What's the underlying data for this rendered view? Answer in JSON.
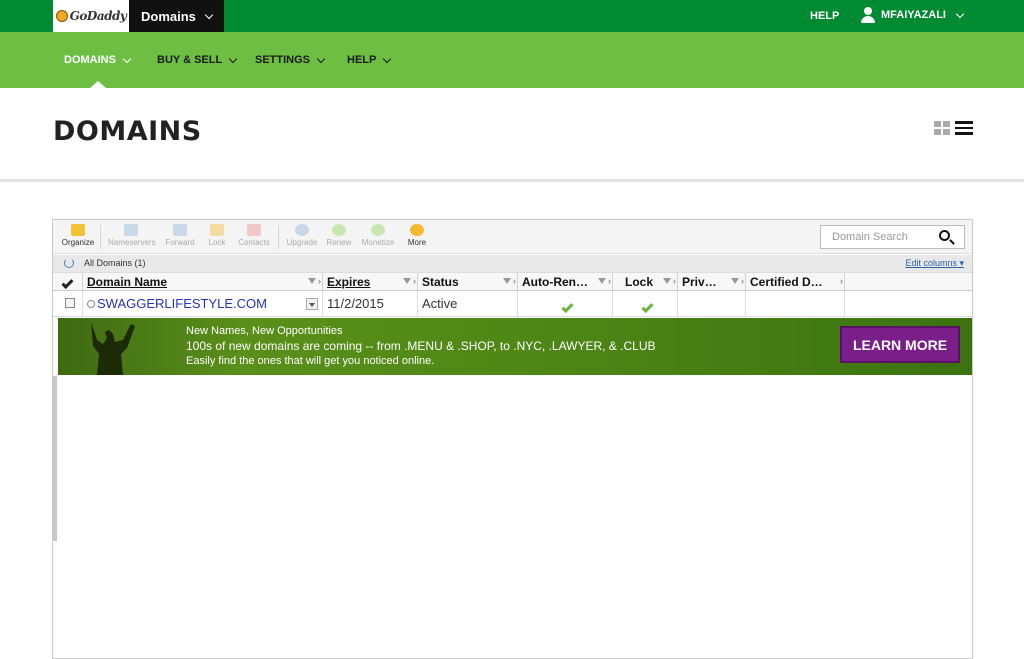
{
  "topbar": {
    "logo_text": "GoDaddy",
    "product_switch": "Domains",
    "help": "HELP",
    "username": "MFAIYAZALI"
  },
  "nav": {
    "items": [
      {
        "label": "DOMAINS"
      },
      {
        "label": "BUY & SELL"
      },
      {
        "label": "SETTINGS"
      },
      {
        "label": "HELP"
      }
    ]
  },
  "page": {
    "title": "DOMAINS"
  },
  "toolbar": {
    "tools": [
      {
        "label": "Organize",
        "enabled": true
      },
      {
        "label": "Nameservers",
        "enabled": false
      },
      {
        "label": "Forward",
        "enabled": false
      },
      {
        "label": "Lock",
        "enabled": false
      },
      {
        "label": "Contacts",
        "enabled": false
      },
      {
        "label": "Upgrade",
        "enabled": false
      },
      {
        "label": "Renew",
        "enabled": false
      },
      {
        "label": "Monetize",
        "enabled": false
      },
      {
        "label": "More",
        "enabled": true
      }
    ],
    "search_placeholder": "Domain Search"
  },
  "list": {
    "all_label": "All Domains (1)",
    "edit_columns": "Edit columns",
    "columns": [
      "Domain Name",
      "Expires",
      "Status",
      "Auto-Ren…",
      "Lock",
      "Priv…",
      "Certified D…"
    ],
    "rows": [
      {
        "domain": "SWAGGERLIFESTYLE.COM",
        "expires": "11/2/2015",
        "status": "Active",
        "auto_renew": true,
        "lock": true
      }
    ]
  },
  "banner": {
    "line1": "New Names, New Opportunities",
    "line2": "100s of new domains are coming -- from .MENU & .SHOP, to .NYC, .LAWYER, & .CLUB",
    "line3": "Easily find the ones that will get you noticed online.",
    "cta": "LEARN MORE"
  },
  "colors": {
    "topbar": "#008a32",
    "navbar": "#6fbe44",
    "cta": "#7a1e8a",
    "link": "#2534b8"
  }
}
